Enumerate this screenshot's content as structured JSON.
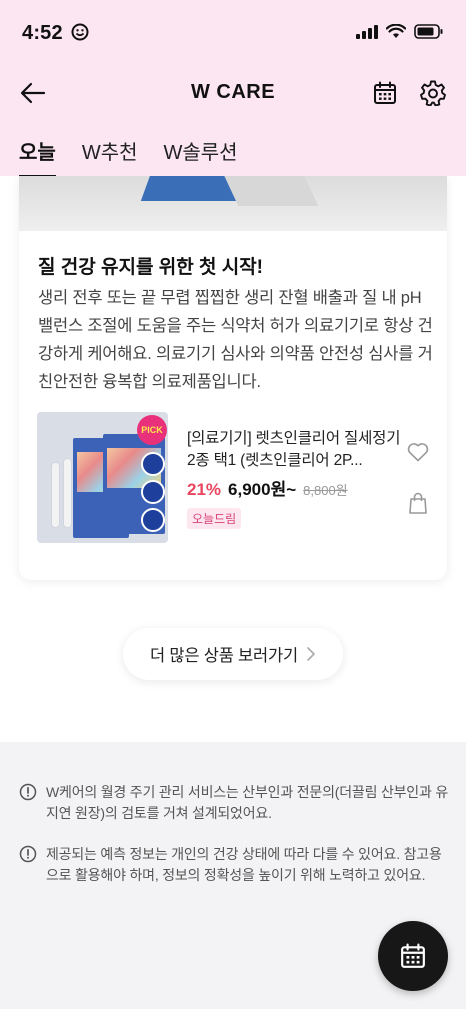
{
  "status_bar": {
    "time": "4:52",
    "time_icon": "smiley-icon"
  },
  "header": {
    "title": "W CARE",
    "back_icon": "arrow-left-icon",
    "calendar_icon": "calendar-icon",
    "settings_icon": "gear-icon"
  },
  "tabs": [
    {
      "label": "오늘",
      "active": true
    },
    {
      "label": "W추천",
      "active": false
    },
    {
      "label": "W솔루션",
      "active": false
    }
  ],
  "card": {
    "title": "질 건강 유지를 위한 첫 시작!",
    "description": "생리 전후 또는 끝 무렵 찝찝한 생리 잔혈 배출과 질 내 pH 밸런스 조절에 도움을 주는 식약처 허가 의료기기로 항상 건강하게 케어해요. 의료기기 심사와 의약품 안전성 심사를 거친안전한 융복합 의료제품입니다.",
    "product": {
      "name": "[의료기기] 렛츠인클리어 질세정기 2종 택1 (렛츠인클리어 2P...",
      "discount": "21%",
      "price": "6,900원~",
      "original_price": "8,800원",
      "tag": "오늘드림",
      "badge_text": "PICK"
    }
  },
  "more_button": {
    "label": "더 많은 상품 보러가기"
  },
  "notices": [
    {
      "text": "W케어의 월경 주기 관리 서비스는 산부인과 전문의(더끌림 산부인과 유지연 원장)의 검토를 거쳐 설계되었어요."
    },
    {
      "text": "제공되는 예측 정보는 개인의 건강 상태에 따라 다를 수 있어요. 참고용으로 활용해야 하며, 정보의 정확성을 높이기 위해 노력하고 있어요."
    }
  ],
  "colors": {
    "header_bg": "#fbe6f1",
    "discount": "#e8465f",
    "tag_text": "#d9407a",
    "tag_bg": "#fde7ef",
    "notice_bg": "#f3f3f5",
    "fab_bg": "#171717"
  }
}
